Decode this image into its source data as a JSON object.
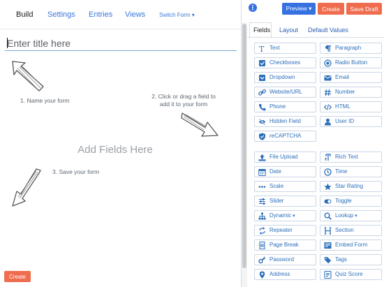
{
  "builder": {
    "tabs": [
      "Build",
      "Settings",
      "Entries",
      "Views"
    ],
    "switch_form": "Switch Form",
    "title_placeholder": "Enter title here",
    "hint_name": "1. Name your form",
    "hint_drag_line1": "2. Click or drag a field to",
    "hint_drag_line2": "add it to your form",
    "hint_save": "3. Save your form",
    "add_fields": "Add Fields Here",
    "create_button": "Create"
  },
  "toolbar": {
    "preview": "Preview",
    "create": "Create",
    "save_draft": "Save Draft"
  },
  "panel": {
    "tabs": [
      "Fields",
      "Layout",
      "Default Values"
    ],
    "fields_left": [
      {
        "label": "Text",
        "icon": "text-icon"
      },
      {
        "label": "Checkboxes",
        "icon": "checkbox-icon"
      },
      {
        "label": "Dropdown",
        "icon": "dropdown-icon"
      },
      {
        "label": "Website/URL",
        "icon": "link-icon"
      },
      {
        "label": "Phone",
        "icon": "phone-icon"
      },
      {
        "label": "Hidden Field",
        "icon": "eye-slash-icon"
      },
      {
        "label": "reCAPTCHA",
        "icon": "shield-icon"
      }
    ],
    "fields_right": [
      {
        "label": "Paragraph",
        "icon": "paragraph-icon"
      },
      {
        "label": "Radio Button",
        "icon": "radio-icon"
      },
      {
        "label": "Email",
        "icon": "email-icon"
      },
      {
        "label": "Number",
        "icon": "hash-icon"
      },
      {
        "label": "HTML",
        "icon": "code-icon"
      },
      {
        "label": "User ID",
        "icon": "user-icon"
      }
    ],
    "advanced_left": [
      {
        "label": "File Upload",
        "icon": "upload-icon"
      },
      {
        "label": "Date",
        "icon": "calendar-icon"
      },
      {
        "label": "Scale",
        "icon": "dots-icon"
      },
      {
        "label": "Slider",
        "icon": "sliders-icon"
      },
      {
        "label": "Dynamic",
        "icon": "sitemap-icon"
      },
      {
        "label": "Repeater",
        "icon": "repeat-icon"
      },
      {
        "label": "Page Break",
        "icon": "page-break-icon"
      },
      {
        "label": "Password",
        "icon": "key-icon"
      },
      {
        "label": "Address",
        "icon": "map-pin-icon"
      }
    ],
    "advanced_right": [
      {
        "label": "Rich Text",
        "icon": "rich-text-icon"
      },
      {
        "label": "Time",
        "icon": "clock-icon"
      },
      {
        "label": "Star Rating",
        "icon": "star-icon"
      },
      {
        "label": "Toggle",
        "icon": "toggle-icon"
      },
      {
        "label": "Lookup",
        "icon": "search-icon"
      },
      {
        "label": "Section",
        "icon": "heading-icon"
      },
      {
        "label": "Embed Form",
        "icon": "embed-icon"
      },
      {
        "label": "Tags",
        "icon": "tags-icon"
      },
      {
        "label": "Quiz Score",
        "icon": "quiz-icon"
      }
    ]
  },
  "colors": {
    "primary": "#3571e0",
    "accent": "#ef6c4e",
    "link": "#2d6fba"
  }
}
